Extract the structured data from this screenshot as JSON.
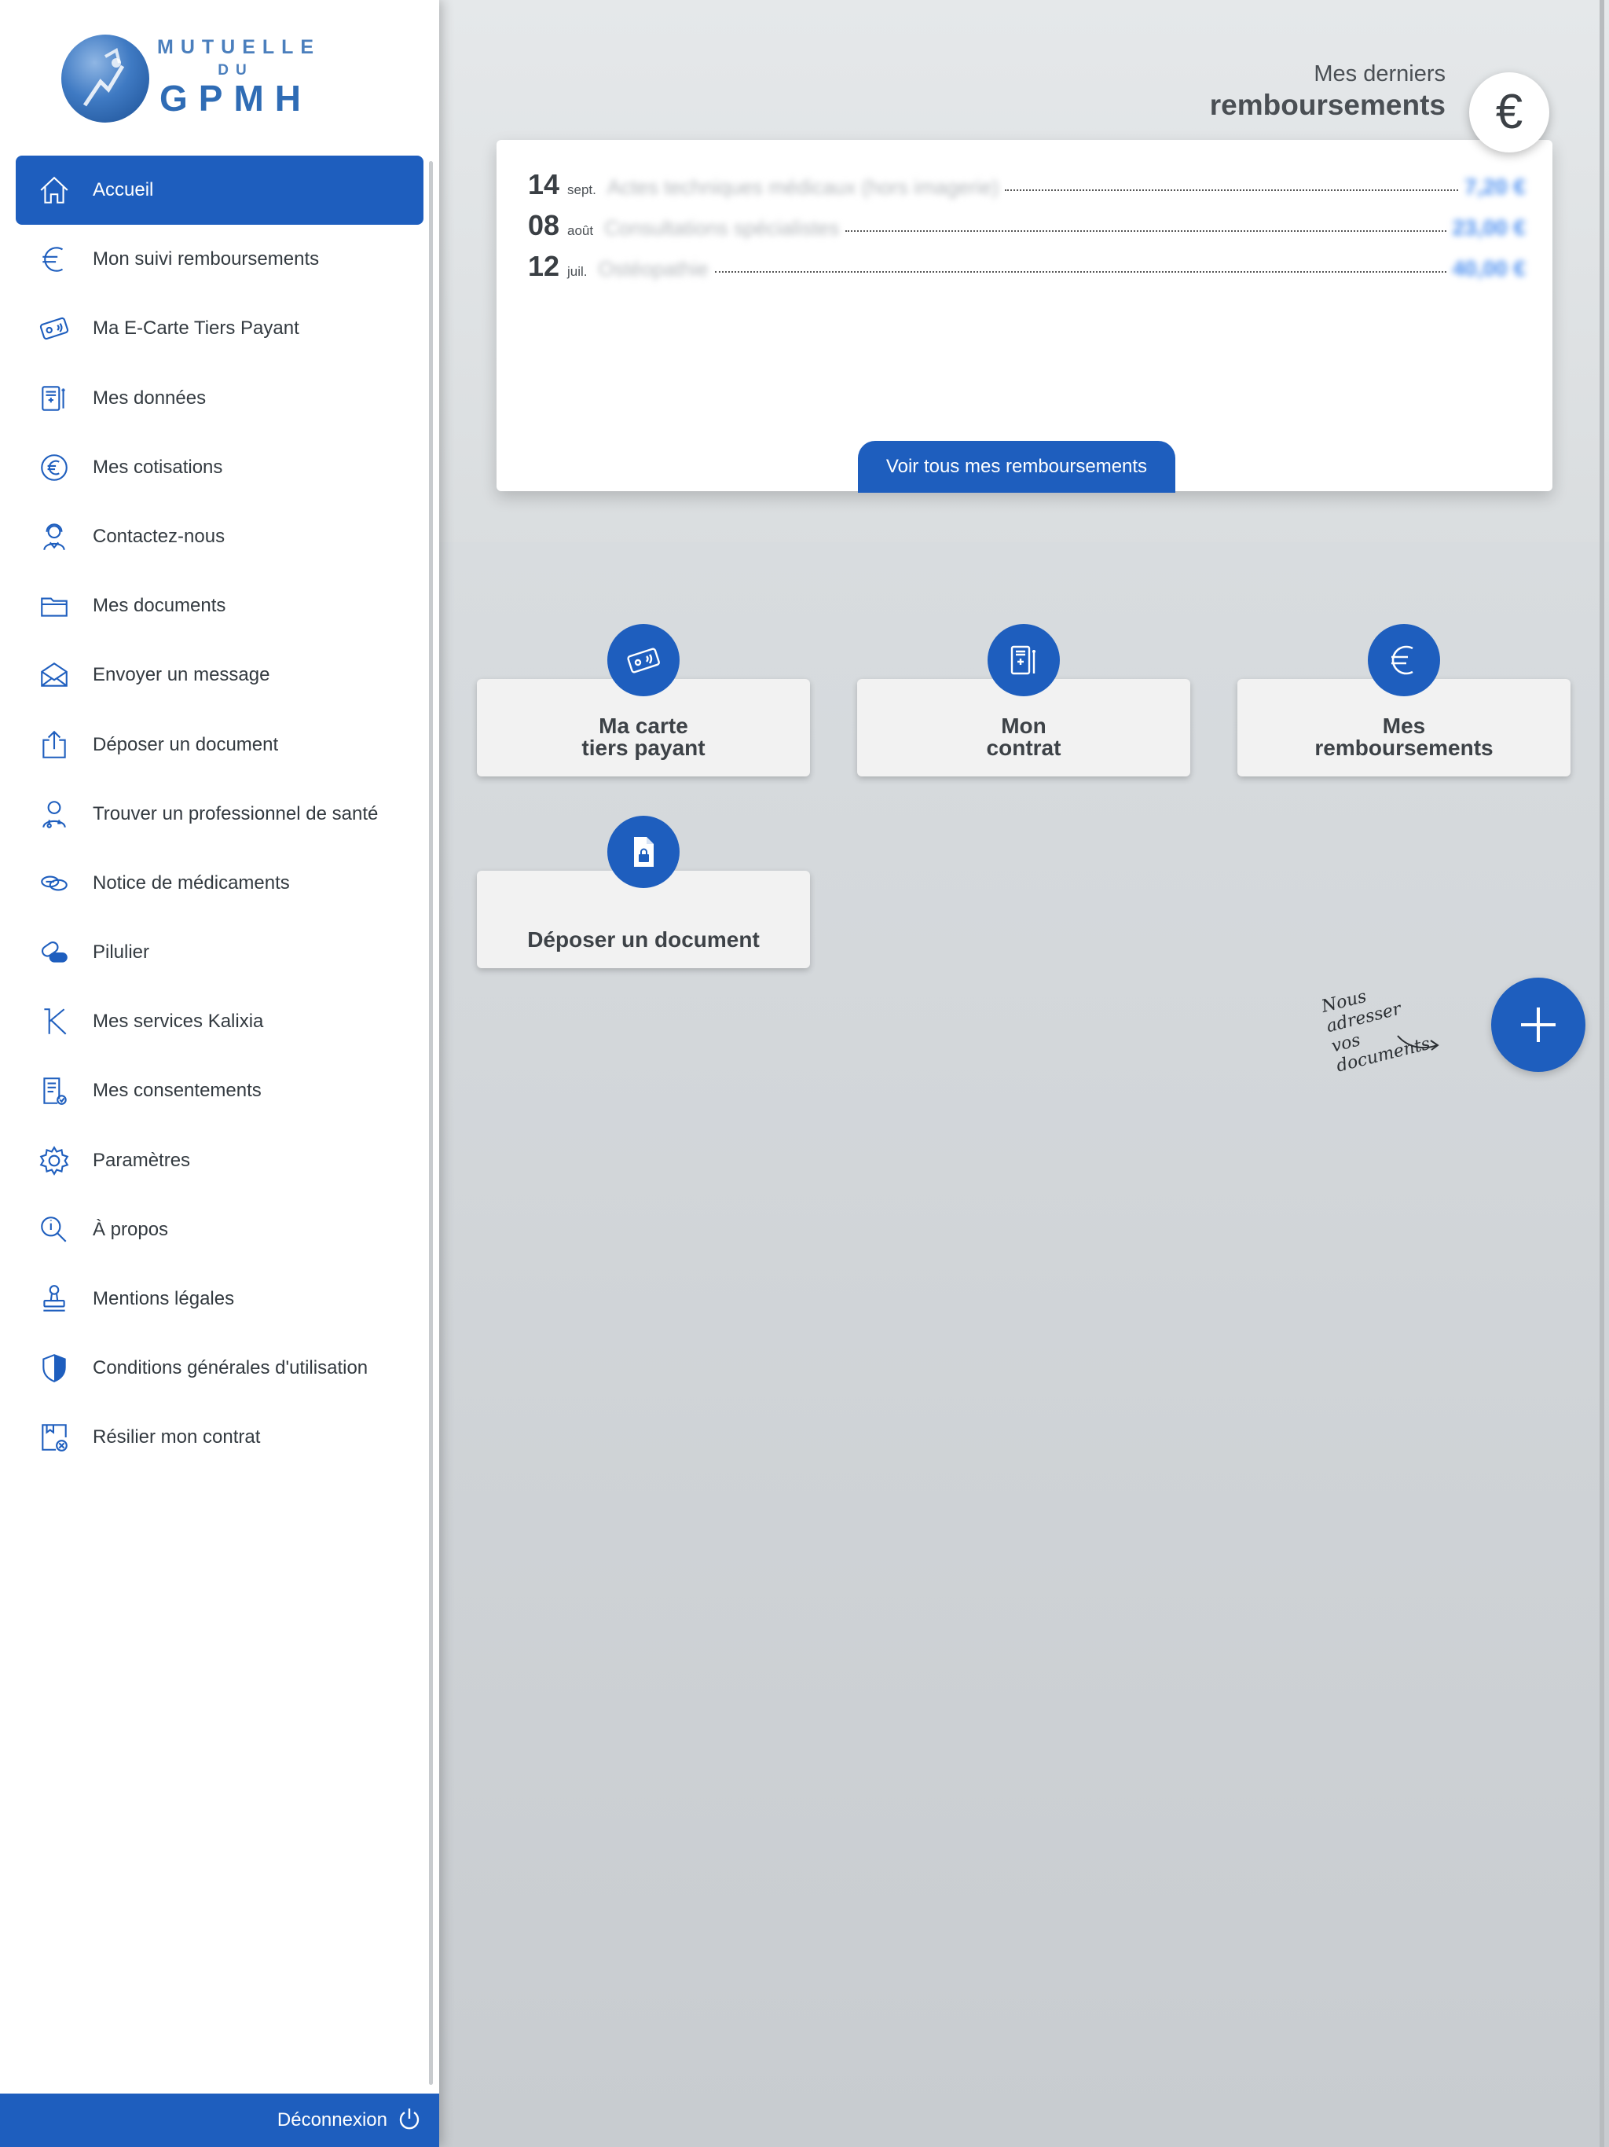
{
  "brand": {
    "line1": "MUTUELLE",
    "line2": "DU",
    "line3": "GPMH"
  },
  "sidebar": {
    "items": [
      {
        "label": "Accueil",
        "icon": "home-icon",
        "active": true
      },
      {
        "label": "Mon suivi remboursements",
        "icon": "euro-icon"
      },
      {
        "label": "Ma E-Carte Tiers Payant",
        "icon": "card-icon"
      },
      {
        "label": "Mes données",
        "icon": "medical-record-icon"
      },
      {
        "label": "Mes cotisations",
        "icon": "euro-circle-icon"
      },
      {
        "label": "Contactez-nous",
        "icon": "support-agent-icon"
      },
      {
        "label": "Mes documents",
        "icon": "folder-icon"
      },
      {
        "label": "Envoyer un message",
        "icon": "envelope-icon"
      },
      {
        "label": "Déposer un document",
        "icon": "upload-icon"
      },
      {
        "label": "Trouver un professionnel de santé",
        "icon": "doctor-icon"
      },
      {
        "label": "Notice de médicaments",
        "icon": "pills-icon"
      },
      {
        "label": "Pilulier",
        "icon": "capsule-icon"
      },
      {
        "label": "Mes services Kalixia",
        "icon": "kalixia-k-icon"
      },
      {
        "label": "Mes consentements",
        "icon": "consent-document-icon"
      },
      {
        "label": "Paramètres",
        "icon": "gear-icon"
      },
      {
        "label": "À propos",
        "icon": "info-search-icon"
      },
      {
        "label": "Mentions légales",
        "icon": "stamp-icon"
      },
      {
        "label": "Conditions générales d'utilisation",
        "icon": "shield-icon"
      },
      {
        "label": "Résilier mon contrat",
        "icon": "cancel-contract-icon"
      }
    ],
    "logout_label": "Déconnexion"
  },
  "header": {
    "small": "Mes derniers",
    "big": "remboursements",
    "euro_symbol": "€"
  },
  "reimbursements": {
    "rows": [
      {
        "day": "14",
        "month": "sept.",
        "label": "Actes techniques médicaux (hors imagerie)",
        "amount": "7,20 €"
      },
      {
        "day": "08",
        "month": "août",
        "label": "Consultations spécialistes",
        "amount": "23,00 €"
      },
      {
        "day": "12",
        "month": "juil.",
        "label": "Ostéopathie",
        "amount": "40,00 €"
      }
    ],
    "see_all_label": "Voir tous mes remboursements"
  },
  "tiles": [
    {
      "line1": "Ma carte",
      "line2": "tiers payant",
      "icon": "card-icon"
    },
    {
      "line1": "Mon",
      "line2": "contrat",
      "icon": "contract-icon"
    },
    {
      "line1": "Mes",
      "line2": "remboursements",
      "icon": "euro-icon"
    },
    {
      "line1": "Déposer un document",
      "line2": "",
      "icon": "document-lock-icon"
    }
  ],
  "fab": {
    "note_line1": "Nous adresser",
    "note_line2": "vos documents",
    "icon": "plus-icon"
  },
  "colors": {
    "accent": "#1e5ebe",
    "text": "#333a40",
    "amount": "#4c8ff0"
  }
}
